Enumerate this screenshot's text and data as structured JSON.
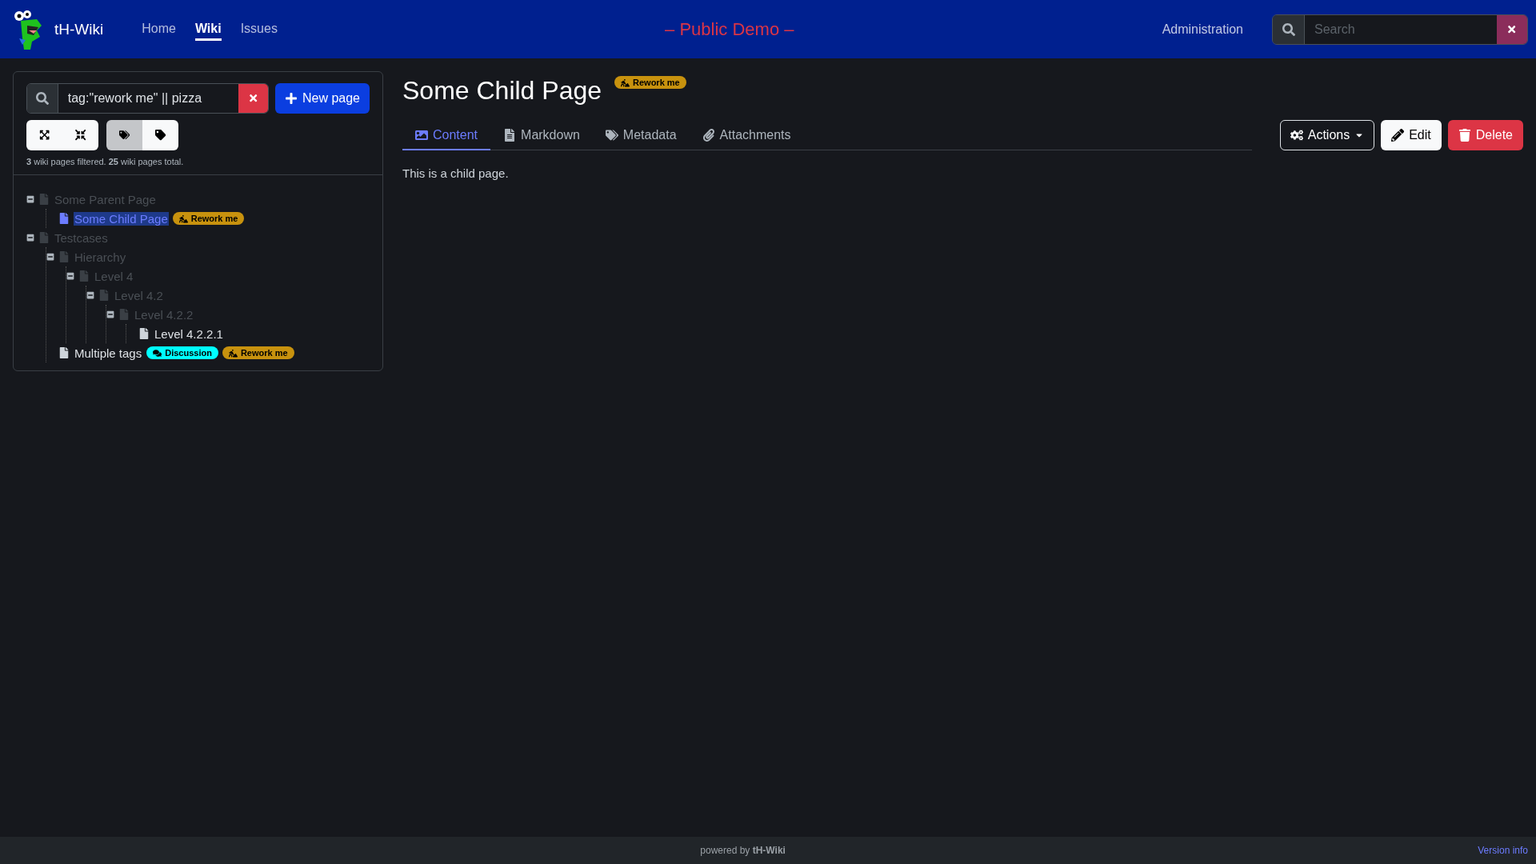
{
  "navbar": {
    "brand": "tH-Wiki",
    "links": [
      {
        "label": "Home",
        "selected": false
      },
      {
        "label": "Wiki",
        "selected": true
      },
      {
        "label": "Issues",
        "selected": false
      }
    ],
    "banner": "– Public Demo –",
    "admin_link": "Administration",
    "search": {
      "placeholder": "Search"
    }
  },
  "sidebar": {
    "filter": {
      "value": "tag:\"rework me\" || pizza"
    },
    "new_page_button": "New page",
    "tag_toggles": [
      {
        "kind": "tags",
        "selected": true
      },
      {
        "kind": "tag",
        "selected": false
      }
    ],
    "summary": "**3** wiki pages filtered. **25** wiki pages total.",
    "tree": [
      {
        "title": "Some Parent Page",
        "matched": false,
        "selected": false,
        "expanded": true,
        "children": [
          {
            "title": "Some Child Page",
            "matched": true,
            "selected": true,
            "tags": [
              {
                "label": "Rework me",
                "kind": "rework"
              }
            ]
          }
        ]
      },
      {
        "title": "Testcases",
        "matched": false,
        "selected": false,
        "expanded": true,
        "children": [
          {
            "title": "Hierarchy",
            "matched": false,
            "selected": false,
            "expanded": true,
            "children": [
              {
                "title": "Level 4",
                "matched": false,
                "selected": false,
                "expanded": true,
                "children": [
                  {
                    "title": "Level 4.2",
                    "matched": false,
                    "selected": false,
                    "expanded": true,
                    "children": [
                      {
                        "title": "Level 4.2.2",
                        "matched": false,
                        "selected": false,
                        "expanded": true,
                        "children": [
                          {
                            "title": "Level 4.2.2.1",
                            "matched": true,
                            "selected": false
                          }
                        ]
                      }
                    ]
                  }
                ]
              }
            ]
          },
          {
            "title": "Multiple tags",
            "matched": true,
            "selected": false,
            "tags": [
              {
                "label": "Discussion",
                "kind": "discussion"
              },
              {
                "label": "Rework me",
                "kind": "rework"
              }
            ]
          }
        ]
      }
    ]
  },
  "page": {
    "title": "Some Child Page",
    "tags": [
      {
        "label": "Rework me",
        "kind": "rework"
      }
    ],
    "tabs": [
      {
        "label": "Content",
        "kind": "content",
        "selected": true
      },
      {
        "label": "Markdown",
        "kind": "markdown",
        "selected": false
      },
      {
        "label": "Metadata",
        "kind": "metadata",
        "selected": false
      },
      {
        "label": "Attachments",
        "kind": "attachments",
        "selected": false
      }
    ],
    "actions": [
      {
        "label": "Actions",
        "kind": "actions"
      },
      {
        "label": "Edit",
        "kind": "edit"
      },
      {
        "label": "Delete",
        "kind": "delete"
      }
    ],
    "content": "This is a child page."
  },
  "footer": {
    "powered": "powered by **tH-Wiki**",
    "version_link": "Version info"
  }
}
